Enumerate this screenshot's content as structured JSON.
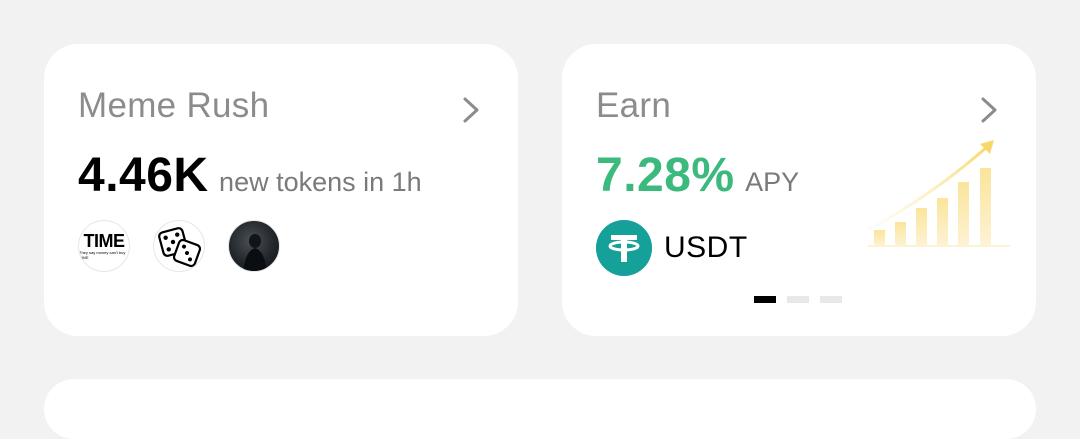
{
  "meme_rush": {
    "title": "Meme Rush",
    "count": "4.46K",
    "subtitle": "new tokens in 1h",
    "avatars": [
      {
        "name": "time-token-avatar",
        "title": "TIME",
        "caption": "They say money can't buy TIME"
      },
      {
        "name": "dice-token-avatar"
      },
      {
        "name": "dark-token-avatar"
      }
    ]
  },
  "earn": {
    "title": "Earn",
    "rate": "7.28%",
    "rate_label": "APY",
    "token": "USDT",
    "pager": {
      "pages": 3,
      "active": 1
    }
  },
  "colors": {
    "background": "#f2f2f2",
    "card": "#ffffff",
    "apy_green": "#3cb97d",
    "usdt_teal": "#16a09a",
    "chart_yellow": "#fbe8a6"
  },
  "icons": [
    "chevron-right-icon",
    "usdt-icon",
    "growth-chart-icon"
  ]
}
